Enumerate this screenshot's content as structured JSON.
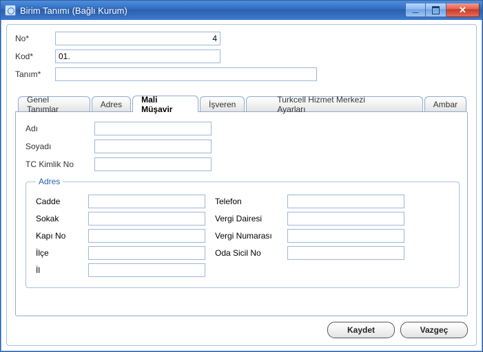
{
  "window": {
    "title": "Birim Tanımı (Bağlı Kurum)"
  },
  "top_fields": {
    "no": {
      "label": "No*",
      "value": "4"
    },
    "kod": {
      "label": "Kod*",
      "value": "01."
    },
    "tanim": {
      "label": "Tanım*",
      "value": ""
    }
  },
  "tabs": {
    "genel": {
      "label": "Genel Tanımlar"
    },
    "adres": {
      "label": "Adres"
    },
    "musavir": {
      "label": "Mali Müşavir"
    },
    "isveren": {
      "label": "İşveren"
    },
    "turkcell": {
      "label": "Turkcell Hizmet Merkezi Ayarları"
    },
    "ambar": {
      "label": "Ambar"
    },
    "active": "musavir"
  },
  "mm": {
    "adi": {
      "label": "Adı",
      "value": ""
    },
    "soyadi": {
      "label": "Soyadı",
      "value": ""
    },
    "tckimlik": {
      "label": "TC Kimlik No",
      "value": ""
    }
  },
  "adres": {
    "legend": "Adres",
    "cadde": {
      "label": "Cadde",
      "value": ""
    },
    "sokak": {
      "label": "Sokak",
      "value": ""
    },
    "kapino": {
      "label": "Kapı No",
      "value": ""
    },
    "ilce": {
      "label": "İlçe",
      "value": ""
    },
    "il": {
      "label": "İl",
      "value": ""
    },
    "telefon": {
      "label": "Telefon",
      "value": ""
    },
    "vdaire": {
      "label": "Vergi Dairesi",
      "value": ""
    },
    "vno": {
      "label": "Vergi Numarası",
      "value": ""
    },
    "odasicil": {
      "label": "Oda Sicil No",
      "value": ""
    }
  },
  "buttons": {
    "save": "Kaydet",
    "cancel": "Vazgeç"
  }
}
